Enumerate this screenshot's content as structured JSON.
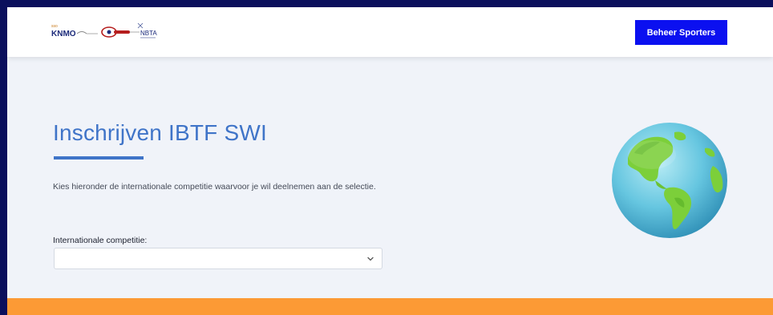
{
  "header": {
    "logo_text_knmo": "KNMO",
    "logo_text_nbta": "NBTA",
    "manage_button_label": "Beheer Sporters"
  },
  "main": {
    "title": "Inschrijven IBTF SWI",
    "intro": "Kies hieronder de internationale competitie waarvoor je wil deelnemen aan de selectie.",
    "competition_field": {
      "label": "Internationale competitie:",
      "value": ""
    }
  },
  "illustration": {
    "icon": "globe-icon"
  },
  "colors": {
    "outer_frame": "#0a0f5c",
    "background": "#f0f3f9",
    "accent_blue": "#3f74c8",
    "button_blue": "#0b10f0",
    "footer_orange": "#fc9a35"
  }
}
